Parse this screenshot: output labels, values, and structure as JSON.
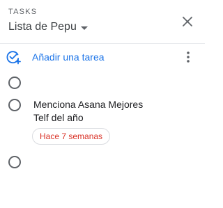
{
  "header": {
    "app_label": "TASKS",
    "list_name": "Lista de Pepu",
    "dropdown_icon": "triangle-down-icon",
    "close_icon": "close-icon"
  },
  "toolbar": {
    "add_task_label": "Añadir una tarea",
    "add_task_icon": "add-task-check-plus-icon",
    "more_icon": "more-vertical-icon"
  },
  "tasks": [
    {
      "title": "",
      "completed": false
    },
    {
      "title": "Menciona Asana Mejores\nTelf del año",
      "completed": false,
      "due": "Hace 7 semanas"
    },
    {
      "title": "",
      "completed": false
    }
  ],
  "colors": {
    "accent": "#1a73e8",
    "overdue": "#d93025",
    "icon": "#5f6368",
    "divider": "#e8eaed"
  }
}
